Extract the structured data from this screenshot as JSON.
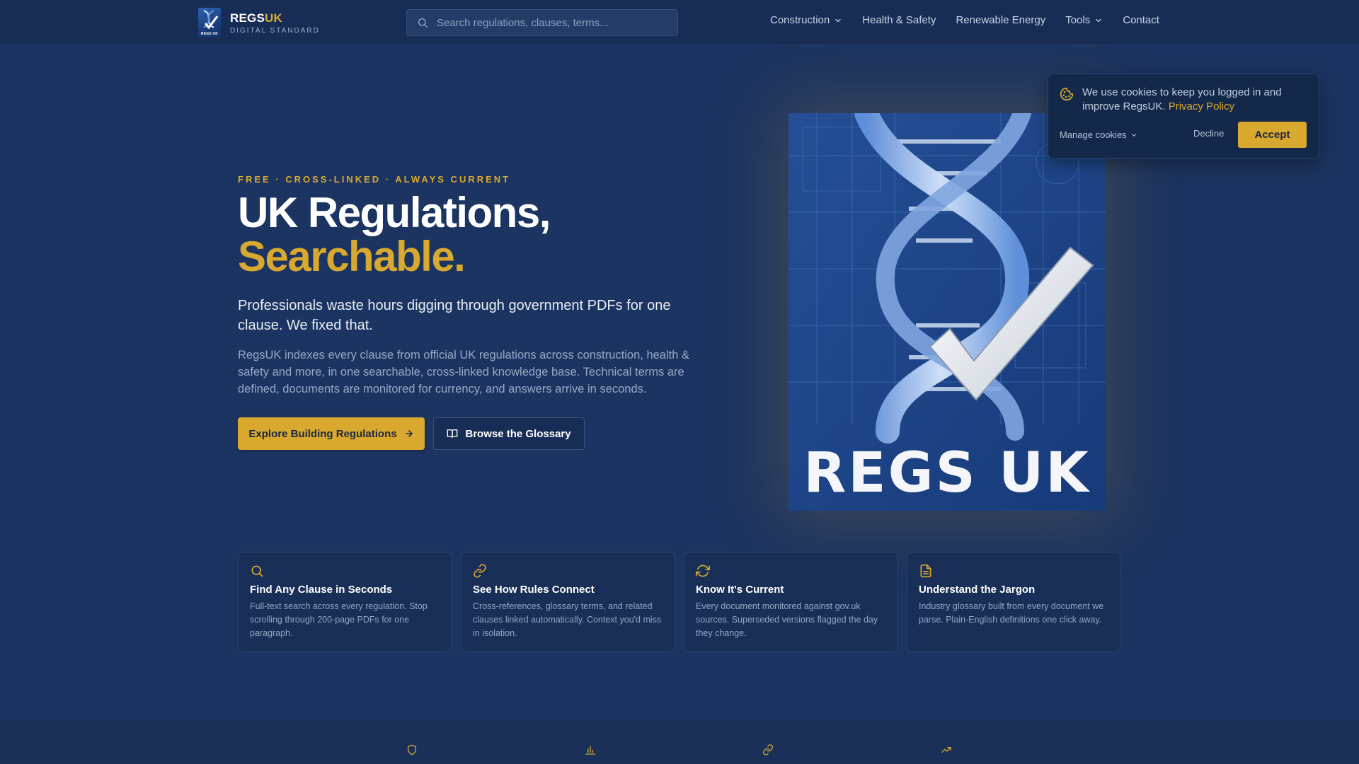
{
  "header": {
    "brand_name_main": "REGS",
    "brand_name_accent": "UK",
    "brand_sub": "DIGITAL STANDARD",
    "logo_small_text": "REGS UK",
    "search_placeholder": "Search regulations, clauses, terms...",
    "nav": [
      {
        "label": "Construction",
        "dropdown": true
      },
      {
        "label": "Health & Safety",
        "dropdown": false
      },
      {
        "label": "Renewable Energy",
        "dropdown": false
      },
      {
        "label": "Tools",
        "dropdown": true
      },
      {
        "label": "Contact",
        "dropdown": false
      }
    ]
  },
  "hero": {
    "eyebrow": "FREE · CROSS-LINKED · ALWAYS CURRENT",
    "title_line1": "UK Regulations,",
    "title_line2": "Searchable.",
    "lead": "Professionals waste hours digging through government PDFs for one clause. We fixed that.",
    "body": "RegsUK indexes every clause from official UK regulations across construction, health & safety and more, in one searchable, cross-linked knowledge base. Technical terms are defined, documents are monitored for currency, and answers arrive in seconds.",
    "primary_button": "Explore Building Regulations",
    "secondary_button": "Browse the Glossary",
    "image_text": "REGS UK"
  },
  "cookie": {
    "text": "We use cookies to keep you logged in and improve RegsUK.",
    "link": "Privacy Policy",
    "manage": "Manage cookies",
    "decline": "Decline",
    "accept": "Accept"
  },
  "features": [
    {
      "icon": "search-icon",
      "title": "Find Any Clause in Seconds",
      "desc": "Full-text search across every regulation. Stop scrolling through 200-page PDFs for one paragraph."
    },
    {
      "icon": "link-icon",
      "title": "See How Rules Connect",
      "desc": "Cross-references, glossary terms, and related clauses linked automatically. Context you'd miss in isolation."
    },
    {
      "icon": "refresh-icon",
      "title": "Know It's Current",
      "desc": "Every document monitored against gov.uk sources. Superseded versions flagged the day they change."
    },
    {
      "icon": "document-icon",
      "title": "Understand the Jargon",
      "desc": "Industry glossary built from every document we parse. Plain-English definitions one click away."
    }
  ],
  "band_icons": [
    "shield-icon",
    "bar-chart-icon",
    "link-icon",
    "trending-up-icon"
  ],
  "colors": {
    "background": "#1c3461",
    "header": "#182d55",
    "accent": "#d9a92f",
    "card": "#192f57",
    "muted_text": "#98a9c6"
  }
}
